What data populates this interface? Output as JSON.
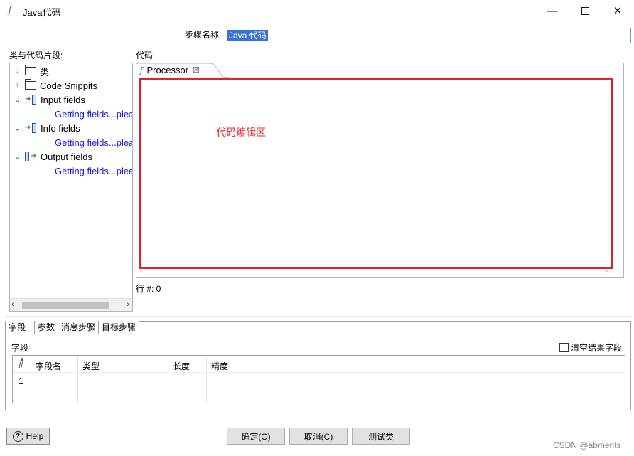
{
  "window": {
    "title": "Java代码",
    "minimize": "—",
    "close": "✕"
  },
  "step": {
    "label": "步骤名称",
    "value": "Java 代码"
  },
  "left_panel": {
    "label": "类与代码片段:",
    "tree": [
      {
        "chevron": "›",
        "label": "类",
        "icon": "folder-icon"
      },
      {
        "chevron": "›",
        "label": "Code Snippits",
        "icon": "folder-icon"
      },
      {
        "chevron": "⌄",
        "label": "Input fields",
        "icon": "input-fields-icon"
      },
      {
        "label": "Getting fields...plea"
      },
      {
        "chevron": "⌄",
        "label": "Info fields",
        "icon": "info-fields-icon"
      },
      {
        "label": "Getting fields...plea"
      },
      {
        "chevron": "⌄",
        "label": "Output fields",
        "icon": "output-fields-icon"
      },
      {
        "label": "Getting fields...plea"
      }
    ],
    "scroll_left": "‹",
    "scroll_right": "›"
  },
  "code": {
    "label": "代码",
    "tab_label": "Processor",
    "tab_close": "☒",
    "annotation": "代码编辑区",
    "line_info": "行 #: 0"
  },
  "bottom_tabs": [
    "字段",
    "参数",
    "消息步骤",
    "目标步骤"
  ],
  "fields": {
    "label": "字段",
    "clear_checkbox_label": "清空结果字段",
    "clear_checked": false,
    "columns": [
      "#",
      "字段名",
      "类型",
      "长度",
      "精度"
    ],
    "rows": [
      [
        "1",
        "",
        "",
        "",
        ""
      ]
    ]
  },
  "buttons": {
    "help": "Help",
    "ok": "确定(O)",
    "cancel": "取消(C)",
    "test": "测试类"
  },
  "watermark": "CSDN @abments",
  "colors": {
    "annotation_red": "#e0222a",
    "selection_blue": "#3874d8",
    "link_blue": "#1a1adb"
  }
}
